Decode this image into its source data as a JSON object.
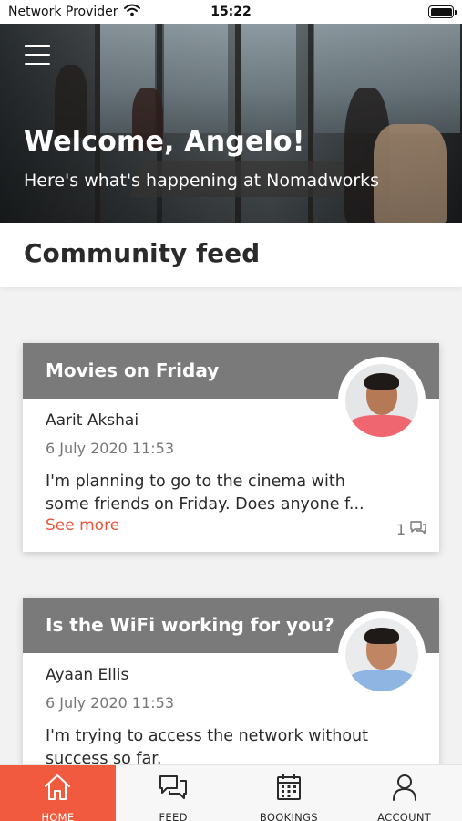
{
  "status_bar": {
    "carrier": "Network Provider",
    "time": "15:22"
  },
  "hero": {
    "title": "Welcome, Angelo!",
    "subtitle": "Here's what's happening at Nomadworks"
  },
  "section": {
    "title": "Community feed"
  },
  "posts": [
    {
      "title": "Movies on Friday",
      "author": "Aarit Akshai",
      "date": "6 July 2020 11:53",
      "text": "I'm planning to go to the cinema with some friends on Friday. Does anyone f...",
      "see_more": "See more",
      "comment_count": "1"
    },
    {
      "title": "Is the WiFi working for you?",
      "author": "Ayaan Ellis",
      "date": "6 July 2020 11:53",
      "text": "I'm trying to access the network without success so far."
    }
  ],
  "tabs": [
    {
      "label": "HOME",
      "icon": "home-icon",
      "active": true
    },
    {
      "label": "FEED",
      "icon": "chat-bubbles-icon",
      "active": false
    },
    {
      "label": "BOOKINGS",
      "icon": "calendar-icon",
      "active": false
    },
    {
      "label": "ACCOUNT",
      "icon": "person-icon",
      "active": false
    }
  ],
  "colors": {
    "accent": "#f15a3e",
    "link": "#e9563b",
    "card_header": "#7a7a7a",
    "background": "#f2f2f2"
  }
}
